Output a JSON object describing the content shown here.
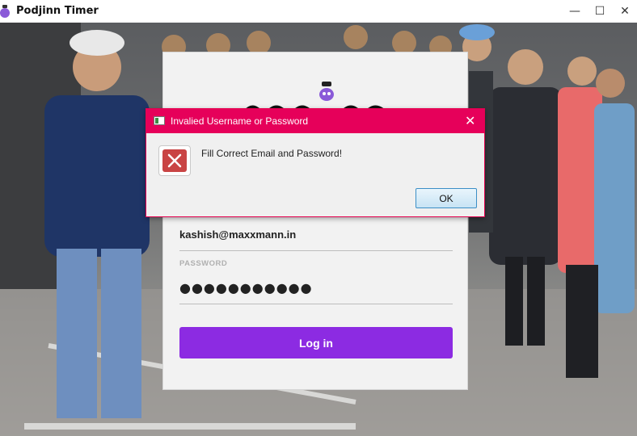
{
  "window": {
    "title": "Podjinn Timer",
    "logo_icon": "podjinn-logo-icon",
    "minimize_label": "—",
    "maximize_label": "☐",
    "close_label": "✕"
  },
  "login": {
    "email_value": "kashish@maxxmann.in",
    "password_label": "PASSWORD",
    "password_value": "●●●●●●●●●●●",
    "login_button_label": "Log in",
    "accent_color": "#8c2be2"
  },
  "dialog": {
    "title": "Invalied Username or Password",
    "message": "Fill Correct Email and Password!",
    "ok_label": "OK",
    "close_label": "✕",
    "error_icon": "error-x-icon",
    "title_bar_color": "#e6005a"
  }
}
